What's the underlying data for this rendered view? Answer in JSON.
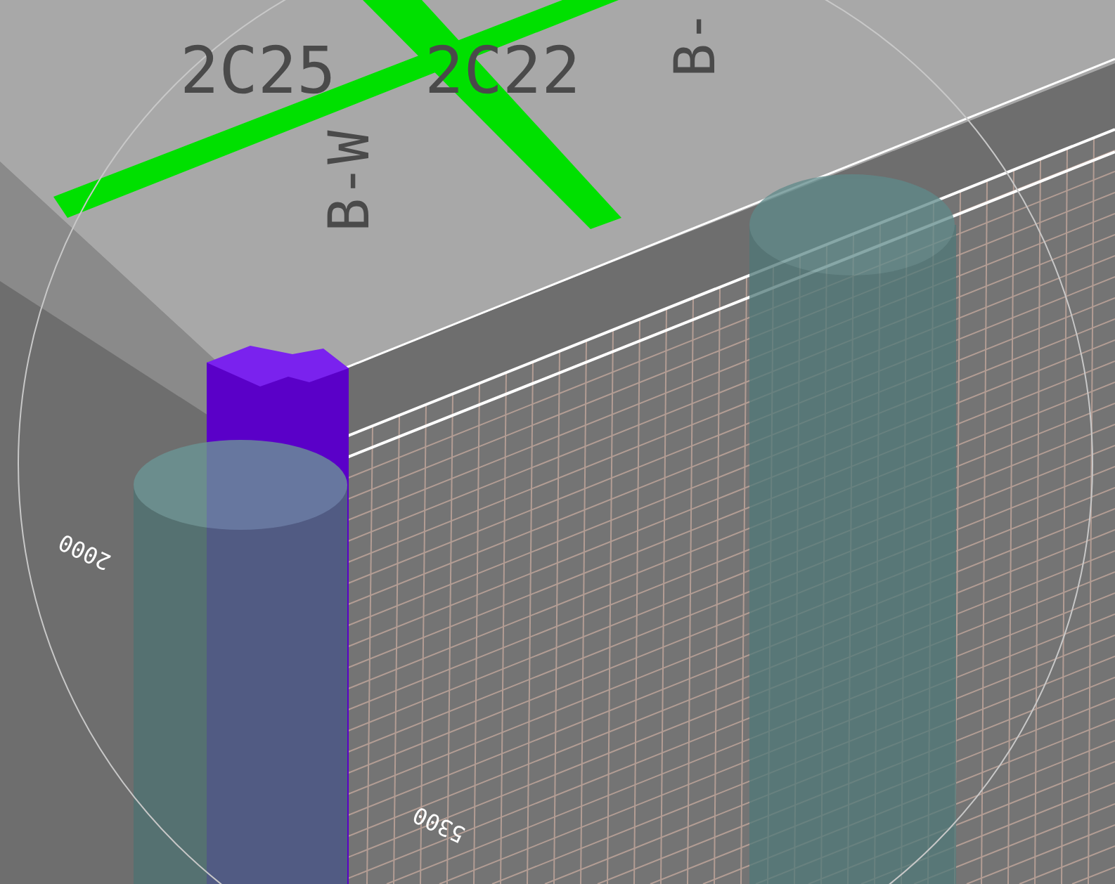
{
  "viewport": {
    "annotations": [
      {
        "kind": "dark",
        "text": "2C25"
      },
      {
        "kind": "dark",
        "text": "2C22"
      },
      {
        "kind": "dark",
        "text": "B-W"
      },
      {
        "kind": "dark",
        "text": "B-"
      },
      {
        "kind": "light",
        "text": "2000"
      },
      {
        "kind": "light",
        "text": "5300"
      }
    ]
  }
}
